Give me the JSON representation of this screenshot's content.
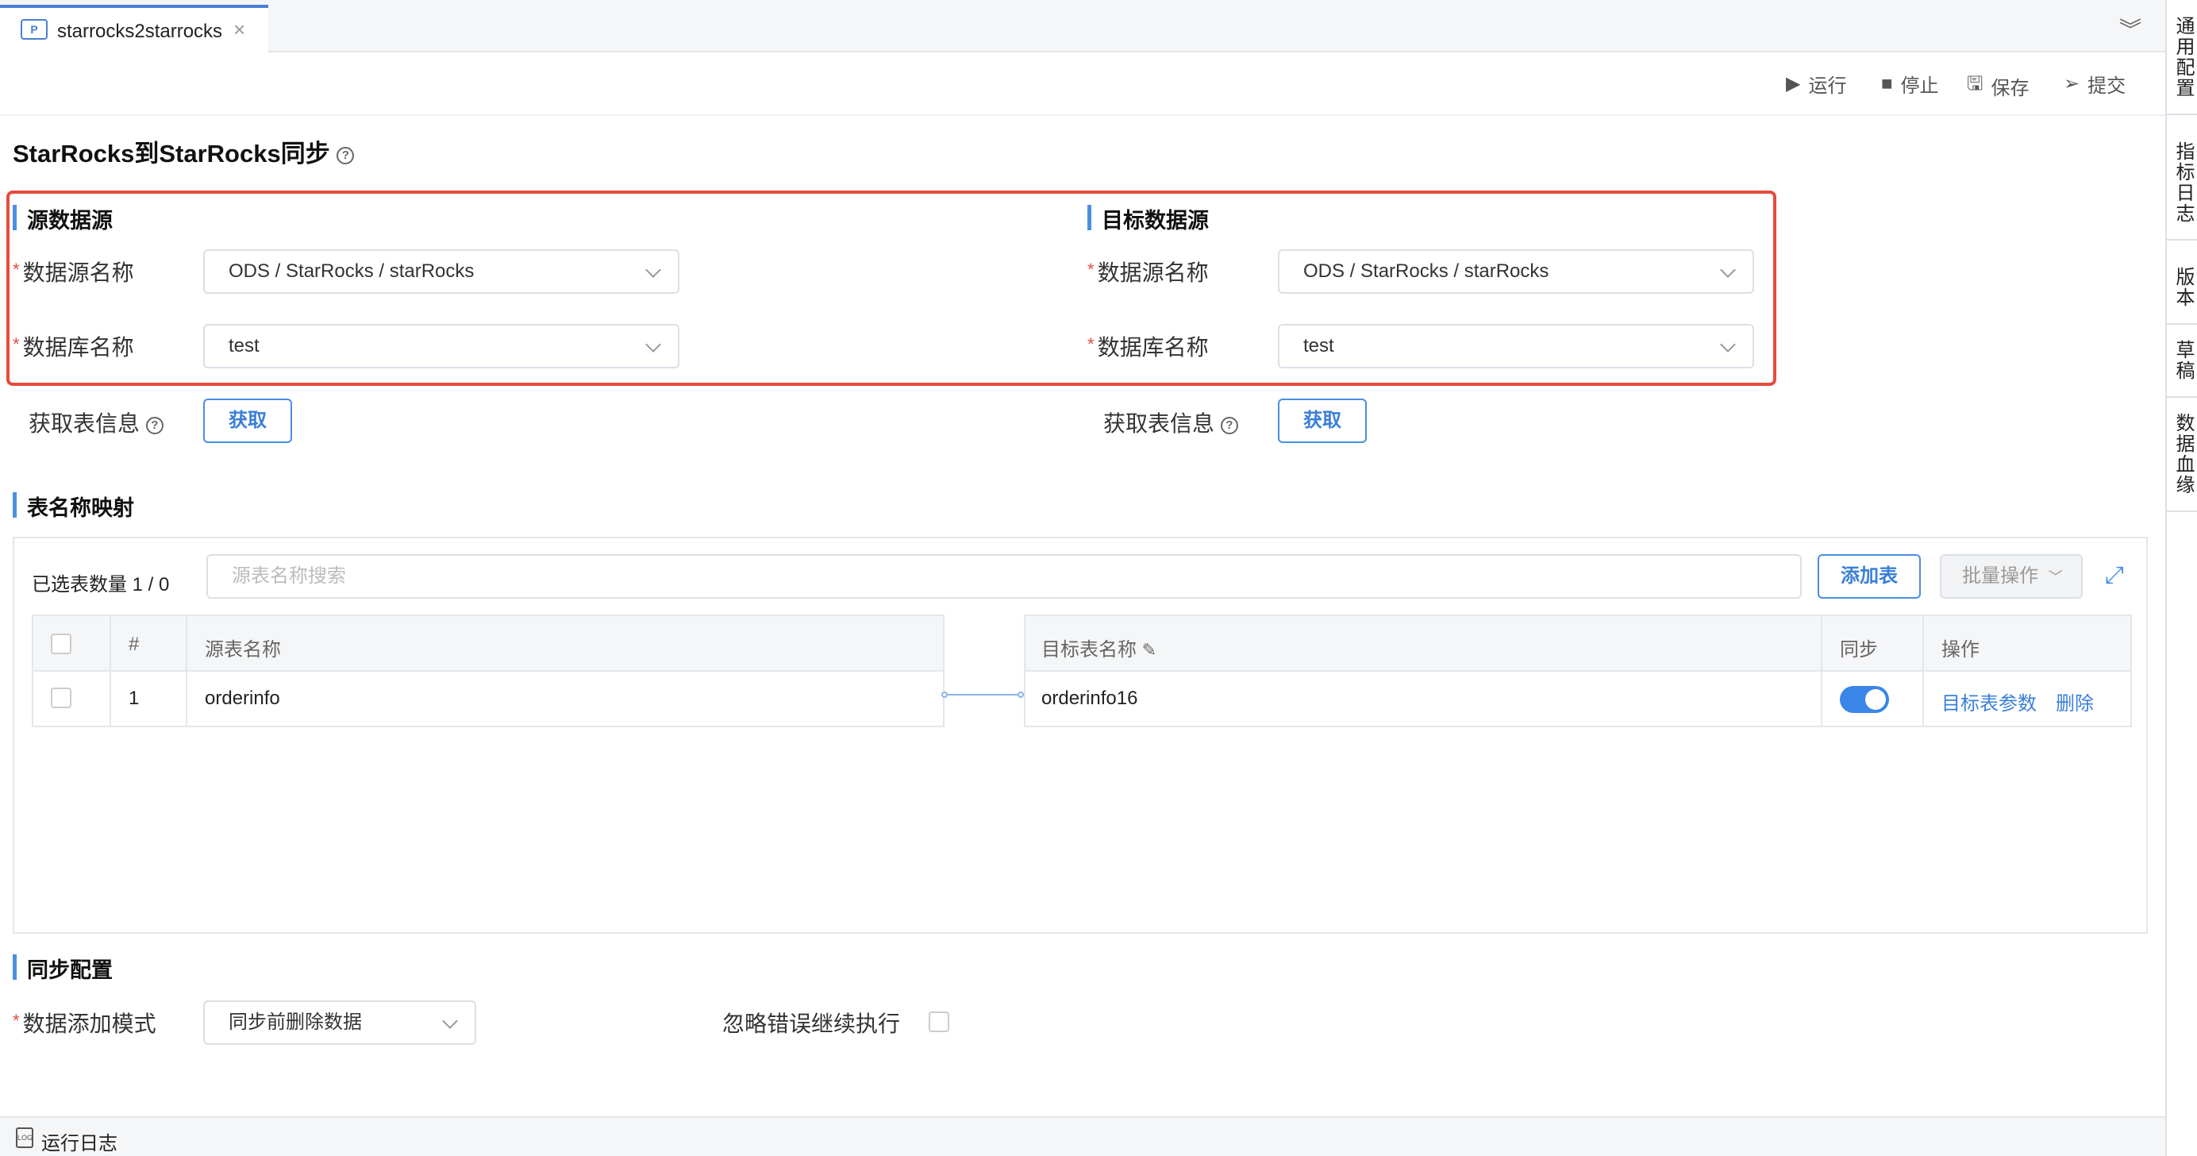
{
  "tab": {
    "icon": "P",
    "label": "starrocks2starrocks"
  },
  "right_menu": [
    "通用配置",
    "指标日志",
    "版本",
    "草稿",
    "数据血缘"
  ],
  "toolbar": {
    "run": "运行",
    "stop": "停止",
    "save": "保存",
    "submit": "提交"
  },
  "page_title": "StarRocks到StarRocks同步",
  "source": {
    "title": "源数据源",
    "datasource_label": "数据源名称",
    "datasource_value": "ODS / StarRocks / starRocks",
    "database_label": "数据库名称",
    "database_value": "test",
    "fetch_label": "获取表信息",
    "fetch_button": "获取"
  },
  "target": {
    "title": "目标数据源",
    "datasource_label": "数据源名称",
    "datasource_value": "ODS / StarRocks / starRocks",
    "database_label": "数据库名称",
    "database_value": "test",
    "fetch_label": "获取表信息",
    "fetch_button": "获取"
  },
  "mapping": {
    "title": "表名称映射",
    "selected_count": "已选表数量 1 / 0",
    "search_placeholder": "源表名称搜索",
    "add_button": "添加表",
    "batch_button": "批量操作",
    "source_headers": {
      "index": "#",
      "name": "源表名称"
    },
    "target_headers": {
      "name": "目标表名称",
      "sync": "同步",
      "ops": "操作"
    },
    "rows": [
      {
        "index": "1",
        "source": "orderinfo",
        "target": "orderinfo16",
        "sync": true,
        "op_params": "目标表参数",
        "op_delete": "删除"
      }
    ]
  },
  "sync_config": {
    "title": "同步配置",
    "mode_label": "数据添加模式",
    "mode_value": "同步前删除数据",
    "ignore_label": "忽略错误继续执行"
  },
  "status_bar": {
    "log_icon": "LOG",
    "log_label": "运行日志"
  },
  "colors": {
    "accent": "#3a86e8",
    "highlight": "#e54b3c",
    "required": "#e54b3c"
  }
}
